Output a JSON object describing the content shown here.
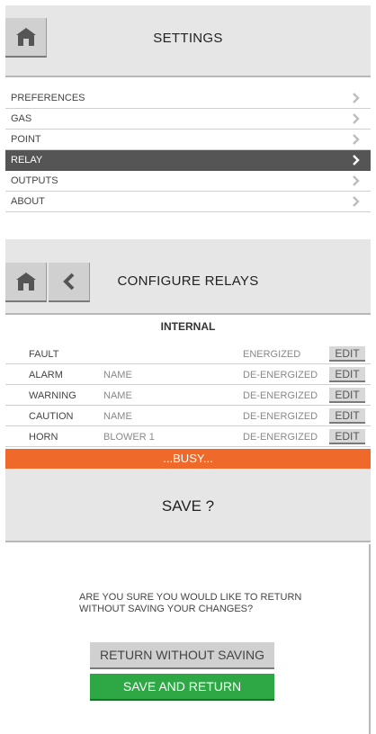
{
  "settings": {
    "title": "SETTINGS",
    "items": [
      {
        "label": "PREFERENCES",
        "active": false
      },
      {
        "label": "GAS",
        "active": false
      },
      {
        "label": "POINT",
        "active": false
      },
      {
        "label": "RELAY",
        "active": true
      },
      {
        "label": "OUTPUTS",
        "active": false
      },
      {
        "label": "ABOUT",
        "active": false
      }
    ]
  },
  "configure": {
    "title": "CONFIGURE RELAYS",
    "section": "INTERNAL",
    "edit_label": "EDIT",
    "rows": [
      {
        "name": "FAULT",
        "label": "",
        "state": "ENERGIZED"
      },
      {
        "name": "ALARM",
        "label": "NAME",
        "state": "DE-ENERGIZED"
      },
      {
        "name": "WARNING",
        "label": "NAME",
        "state": "DE-ENERGIZED"
      },
      {
        "name": "CAUTION",
        "label": "NAME",
        "state": "DE-ENERGIZED"
      },
      {
        "name": "HORN",
        "label": "BLOWER 1",
        "state": "DE-ENERGIZED"
      }
    ],
    "busy_text": "...BUSY..."
  },
  "dialog": {
    "title": "SAVE ?",
    "message": "ARE YOU SURE YOU WOULD LIKE TO RETURN WITHOUT SAVING YOUR CHANGES?",
    "return_label": "RETURN WITHOUT SAVING",
    "save_label": "SAVE AND RETURN"
  },
  "icons": {
    "home": "home-icon",
    "back": "chevron-left-icon",
    "chevron": "chevron-right-icon"
  },
  "colors": {
    "header_bg": "#e6e6e6",
    "active_row": "#555555",
    "busy_bar": "#ef6a2a",
    "save_button": "#2ea845"
  }
}
